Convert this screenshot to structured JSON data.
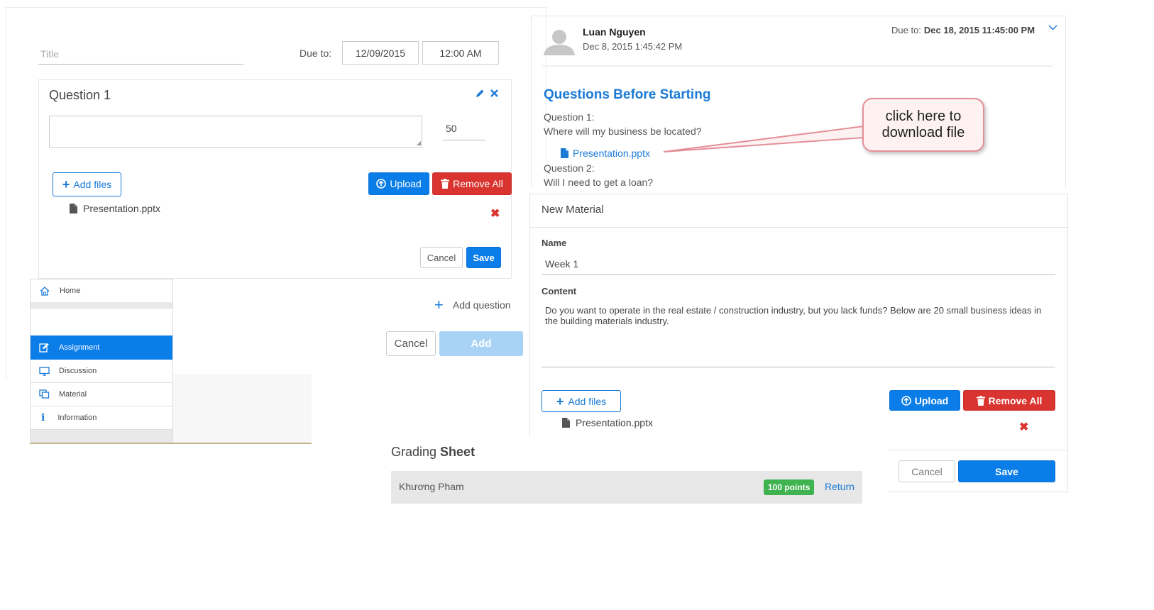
{
  "assignment_form": {
    "title_placeholder": "Title",
    "due_label": "Due to:",
    "due_date": "12/09/2015",
    "due_time": "12:00 AM",
    "question_title": "Question 1",
    "points_value": "50",
    "add_files_label": "Add files",
    "upload_label": "Upload",
    "remove_all_label": "Remove All",
    "file_name": "Presentation.pptx",
    "cancel_label": "Cancel",
    "save_label": "Save",
    "add_question_label": "Add question",
    "bottom_cancel_label": "Cancel",
    "add_label": "Add"
  },
  "sidebar": {
    "items": [
      {
        "label": "Home",
        "icon": "home-icon"
      },
      {
        "label": "Assignment",
        "icon": "edit-icon",
        "active": true
      },
      {
        "label": "Discussion",
        "icon": "monitor-icon"
      },
      {
        "label": "Material",
        "icon": "copy-icon"
      },
      {
        "label": "Information",
        "icon": "info-icon"
      }
    ],
    "active_color": "#0a7de8"
  },
  "post": {
    "author": "Luan Nguyen",
    "timestamp": "Dec 8, 2015 1:45:42 PM",
    "due_label": "Due to:",
    "due_value": "Dec 18, 2015 11:45:00 PM",
    "heading": "Questions Before Starting",
    "q1_label": "Question 1:",
    "q1_text": "Where will my business be located?",
    "attachment": "Presentation.pptx",
    "q2_label": "Question 2:",
    "q2_text": "Will I need to get a loan?",
    "callout_line1": "click here to",
    "callout_line2": "download file"
  },
  "material": {
    "header": "New Material",
    "name_label": "Name",
    "name_value": "Week 1",
    "content_label": "Content",
    "content_value": "Do you want to operate in the real estate / construction industry, but you lack funds? Below are 20 small business ideas in the building materials industry.",
    "add_files_label": "Add files",
    "upload_label": "Upload",
    "remove_all_label": "Remove All",
    "file_name": "Presentation.pptx",
    "cancel_label": "Cancel",
    "save_label": "Save"
  },
  "grading": {
    "title_prefix": "Grading ",
    "title_bold": "Sheet",
    "student": "Khương Pham",
    "points_badge": "100 points",
    "return_label": "Return",
    "badge_color": "#3fb34f"
  }
}
